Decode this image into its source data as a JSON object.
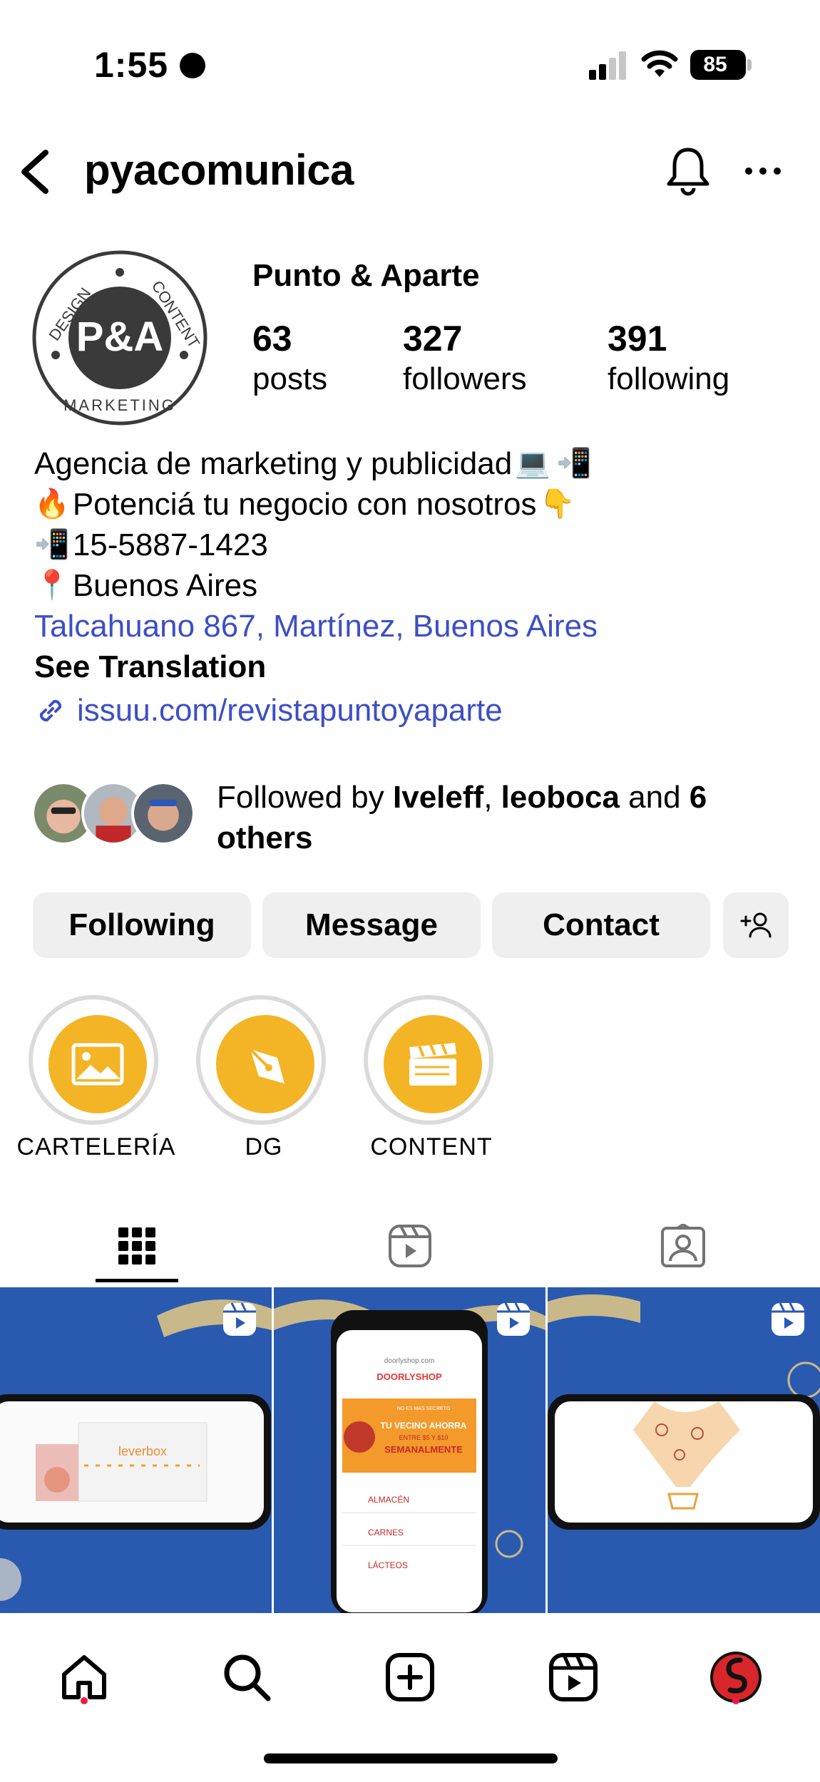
{
  "status_bar": {
    "time": "1:55",
    "battery": "85"
  },
  "header": {
    "username": "pyacomunica"
  },
  "profile": {
    "display_name": "Punto & Aparte",
    "avatar_text": "P&A",
    "avatar_ring": {
      "top": "DESIGN",
      "right": "CONTENT",
      "bottom": "MARKETING"
    },
    "stats": [
      {
        "value": "63",
        "label": "posts"
      },
      {
        "value": "327",
        "label": "followers"
      },
      {
        "value": "391",
        "label": "following"
      }
    ]
  },
  "bio": {
    "line1": "Agencia de marketing y publicidad",
    "line1_emojis": [
      "💻",
      "📲"
    ],
    "line2_emoji": "🔥",
    "line2": "Potenciá tu negocio con nosotros",
    "line2_emoji_end": "👇",
    "line3_emoji": "📲",
    "line3": "15-5887-1423",
    "line4_emoji": "📍",
    "line4": "Buenos Aires",
    "address": "Talcahuano 867, Martínez, Buenos Aires",
    "see_translation": "See Translation",
    "link": "issuu.com/revistapuntoyaparte"
  },
  "followed_by": {
    "prefix": "Followed by ",
    "name1": "Iveleff",
    "sep": ", ",
    "name2": "leoboca",
    "and": " and ",
    "others": "6 others"
  },
  "actions": {
    "following": "Following",
    "message": "Message",
    "contact": "Contact"
  },
  "highlights": [
    {
      "label": "CARTELERÍA",
      "icon": "image-icon"
    },
    {
      "label": "DG",
      "icon": "pen-nib-icon"
    },
    {
      "label": "CONTENT",
      "icon": "clapperboard-icon"
    }
  ],
  "tabs": [
    "grid-icon",
    "reels-icon",
    "tagged-icon"
  ],
  "grid": {
    "post1": {
      "brand": "leverbox"
    },
    "post2": {
      "site": "doorlyshop.com",
      "brand": "DOORLYSHOP",
      "banner_small": "NO ES MAS SECRETO",
      "banner_main": "TU VECINO AHORRA",
      "banner_sub": "ENTRE $5 Y $10",
      "banner_week": "SEMANALMENTE",
      "menu": [
        "ALMACÉN",
        "CARNES",
        "LÁCTEOS"
      ]
    },
    "post3": {}
  },
  "nav": [
    "home-icon",
    "search-icon",
    "create-icon",
    "reels-icon",
    "profile-avatar"
  ],
  "colors": {
    "link": "#3d4fc5",
    "button_bg": "#efefef",
    "highlight": "#f3b526",
    "post_bg": "#2a5ab0",
    "notification_dot": "#ed1c45"
  }
}
